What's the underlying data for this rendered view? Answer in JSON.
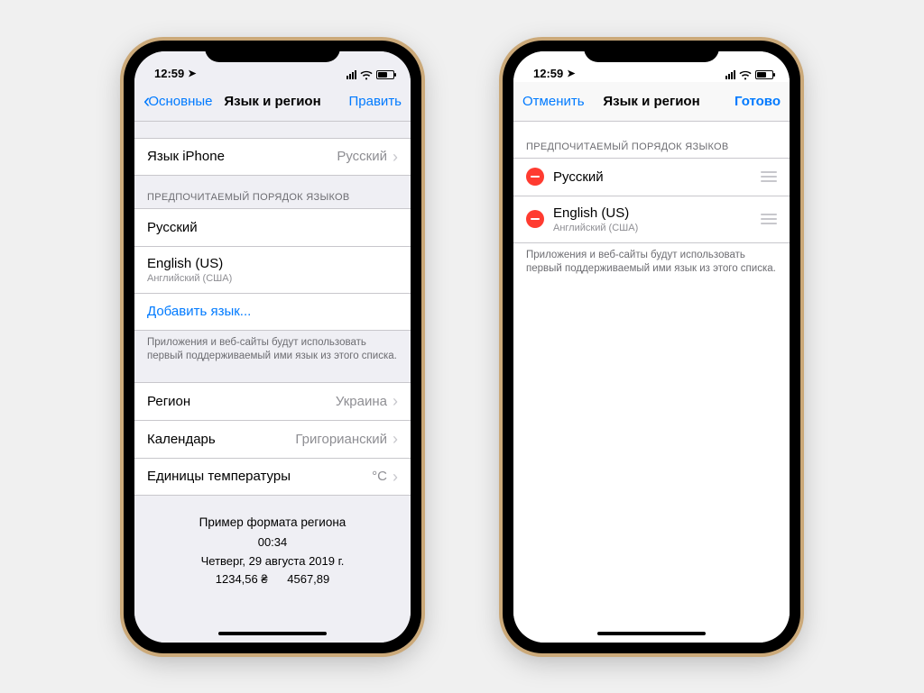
{
  "status": {
    "time": "12:59"
  },
  "phone1": {
    "nav": {
      "back": "Основные",
      "title": "Язык и регион",
      "edit": "Править"
    },
    "iphoneLangRow": {
      "label": "Язык iPhone",
      "value": "Русский"
    },
    "langHeader": "ПРЕДПОЧИТАЕМЫЙ ПОРЯДОК ЯЗЫКОВ",
    "langs": [
      {
        "label": "Русский",
        "sub": ""
      },
      {
        "label": "English (US)",
        "sub": "Английский (США)"
      }
    ],
    "addLang": "Добавить язык...",
    "langFooter": "Приложения и веб-сайты будут использовать первый поддерживаемый ими язык из этого списка.",
    "region": {
      "label": "Регион",
      "value": "Украина"
    },
    "calendar": {
      "label": "Календарь",
      "value": "Григорианский"
    },
    "tempUnits": {
      "label": "Единицы температуры",
      "value": "°C"
    },
    "example": {
      "title": "Пример формата региона",
      "time": "00:34",
      "date": "Четверг, 29 августа 2019 г.",
      "numbers": "1234,56 ₴      4567,89"
    }
  },
  "phone2": {
    "nav": {
      "cancel": "Отменить",
      "title": "Язык и регион",
      "done": "Готово"
    },
    "langHeader": "ПРЕДПОЧИТАЕМЫЙ ПОРЯДОК ЯЗЫКОВ",
    "langs": [
      {
        "label": "Русский",
        "sub": ""
      },
      {
        "label": "English (US)",
        "sub": "Английский (США)"
      }
    ],
    "langFooter": "Приложения и веб-сайты будут использовать первый поддерживаемый ими язык из этого списка."
  }
}
